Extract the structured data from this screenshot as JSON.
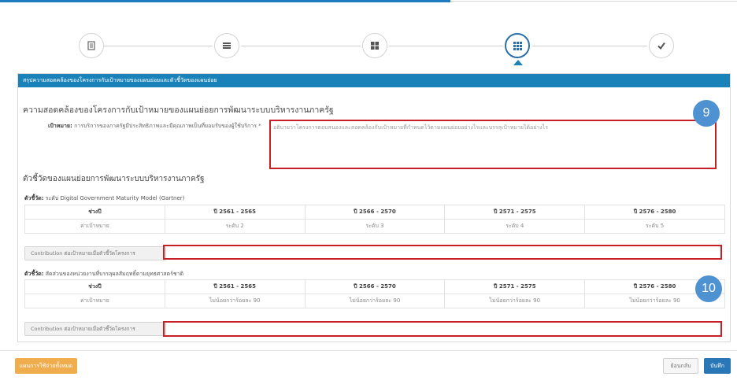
{
  "stepper": {
    "steps": [
      {
        "icon": "document-icon",
        "active": false
      },
      {
        "icon": "list-icon",
        "active": false
      },
      {
        "icon": "grid-four-icon",
        "active": false
      },
      {
        "icon": "grid-nine-icon",
        "active": true
      },
      {
        "icon": "check-icon",
        "active": false
      }
    ]
  },
  "panel": {
    "header": "สรุปความสอดคล้องของโครงการกับเป้าหมายของแผนย่อยและตัวชี้วัดของแผนย่อย",
    "alignment_title": "ความสอดคล้องของโครงการกับเป้าหมายของแผนย่อยการพัฒนาระบบบริหารงานภาครัฐ",
    "goal_label_bold": "เป้าหมาย:",
    "goal_label_text": "การบริการของภาครัฐมีประสิทธิภาพและมีคุณภาพเป็นที่ยอมรับของผู้ใช้บริการ *",
    "goal_textarea_placeholder": "อธิบายว่าโครงการตอบสนองและสอดคล้องกับเป้าหมายที่กำหนดไว้ตามแผนย่อยอย่างไรและบรรลุเป้าหมายได้อย่างไร",
    "indicator_title": "ตัวชี้วัดของแผนย่อยการพัฒนาระบบบริหารงานภาครัฐ",
    "badge_9": "9",
    "badge_10": "10"
  },
  "kpi1": {
    "label_bold": "ตัวชี้วัด:",
    "label_text": "ระดับ Digital Government Maturity Model (Gartner)",
    "headers": [
      "ช่วงปี",
      "ปี 2561 - 2565",
      "ปี 2566 - 2570",
      "ปี 2571 - 2575",
      "ปี 2576 - 2580"
    ],
    "row": [
      "ค่าเป้าหมาย",
      "ระดับ 2",
      "ระดับ 3",
      "ระดับ 4",
      "ระดับ 5"
    ],
    "contributor_label": "Contribution ต่อเป้าหมายเมื่อตัวชี้วัดโครงการ"
  },
  "kpi2": {
    "label_bold": "ตัวชี้วัด:",
    "label_text": "สัดส่วนของหน่วยงานที่บรรลุผลสัมฤทธิ์ตามยุทธศาสตร์ชาติ",
    "headers": [
      "ช่วงปี",
      "ปี 2561 - 2565",
      "ปี 2566 - 2570",
      "ปี 2571 - 2575",
      "ปี 2576 - 2580"
    ],
    "row": [
      "ค่าเป้าหมาย",
      "ไม่น้อยกว่าร้อยละ 90",
      "ไม่น้อยกว่าร้อยละ 90",
      "ไม่น้อยกว่าร้อยละ 90",
      "ไม่น้อยกว่าร้อยละ 90"
    ],
    "contributor_label": "Contribution ต่อเป้าหมายเมื่อตัวชี้วัดโครงการ"
  },
  "footer": {
    "left_button": "แผนการใช้จ่ายทั้งหมด",
    "back_button": "ย้อนกลับ",
    "save_button": "บันทึก"
  },
  "colors": {
    "accent": "#1f7bbf",
    "header_bar": "#1983b9",
    "highlight_red": "#c81e25",
    "badge_blue": "#4f92d2",
    "orange": "#f0ad4e",
    "save_blue": "#2a77b8"
  }
}
